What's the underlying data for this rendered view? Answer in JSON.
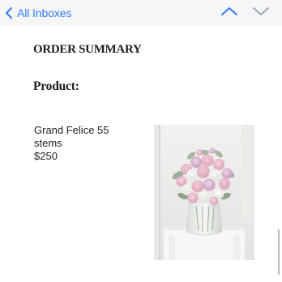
{
  "navbar": {
    "back_label": "All Inboxes",
    "accent_color": "#2f7bf6",
    "icons": {
      "back": "chevron-left-icon",
      "previous": "chevron-up-icon",
      "next": "chevron-down-icon"
    }
  },
  "email": {
    "order_summary_title": "ORDER SUMMARY",
    "product_heading": "Product:",
    "product": {
      "name": "Grand Felice 55 stems",
      "price": "$250",
      "image": "pink-and-white-rose-bouquet-in-glass-vase"
    }
  }
}
